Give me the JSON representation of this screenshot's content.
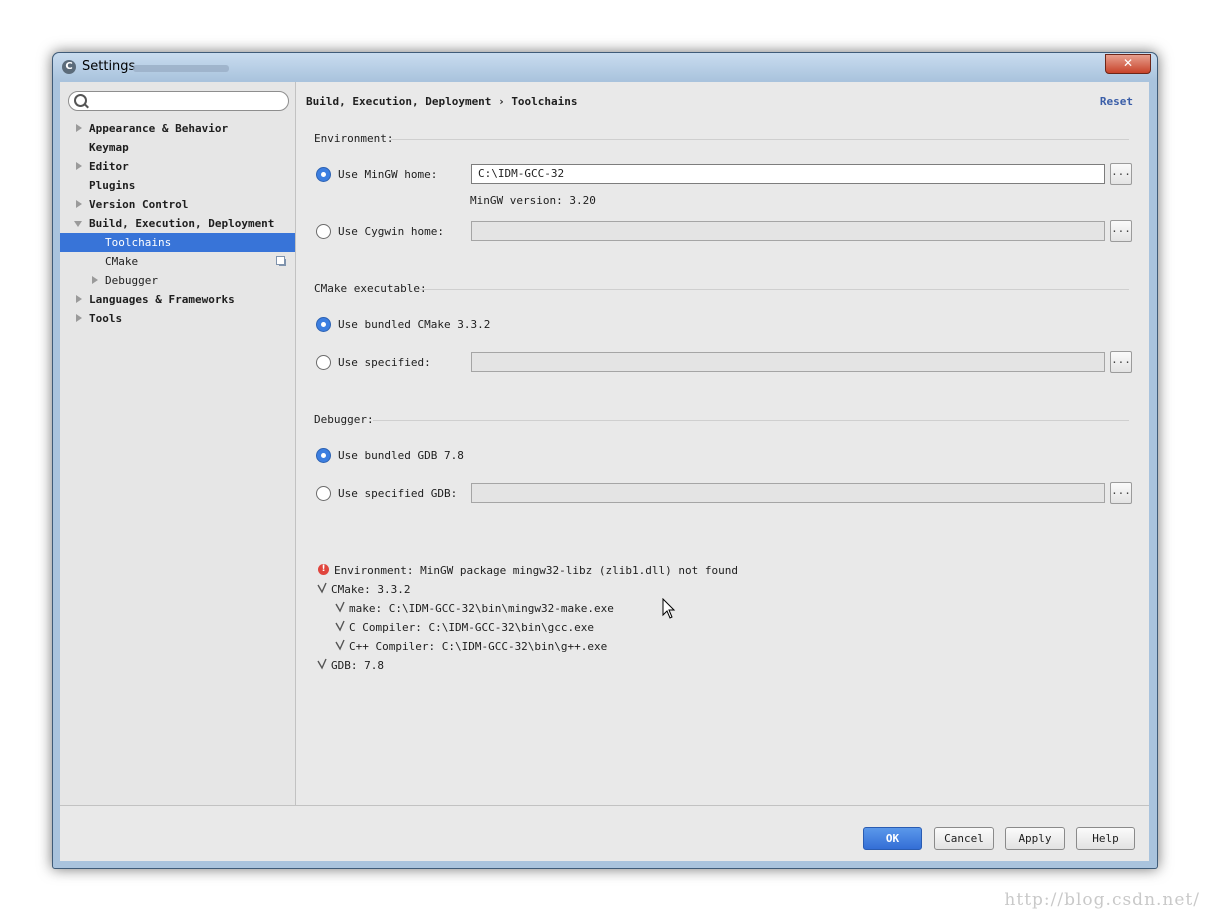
{
  "window": {
    "title": "Settings",
    "close_glyph": "✕"
  },
  "search": {
    "placeholder": ""
  },
  "sidebar": {
    "items": [
      {
        "label": "Appearance & Behavior"
      },
      {
        "label": "Keymap"
      },
      {
        "label": "Editor"
      },
      {
        "label": "Plugins"
      },
      {
        "label": "Version Control"
      },
      {
        "label": "Build, Execution, Deployment"
      },
      {
        "label": "Toolchains"
      },
      {
        "label": "CMake"
      },
      {
        "label": "Debugger"
      },
      {
        "label": "Languages & Frameworks"
      },
      {
        "label": "Tools"
      }
    ]
  },
  "header": {
    "crumb_parent": "Build, Execution, Deployment",
    "crumb_sep": "›",
    "crumb_current": "Toolchains",
    "reset": "Reset"
  },
  "environment": {
    "title": "Environment:",
    "mingw_label": "Use MinGW home:",
    "mingw_value": "C:\\IDM-GCC-32",
    "mingw_version": "MinGW version: 3.20",
    "cygwin_label": "Use Cygwin home:",
    "cygwin_value": ""
  },
  "cmake": {
    "title": "CMake executable:",
    "bundled_label": "Use bundled CMake 3.3.2",
    "specified_label": "Use specified:",
    "specified_value": ""
  },
  "debugger": {
    "title": "Debugger:",
    "bundled_label": "Use bundled GDB 7.8",
    "specified_label": "Use specified GDB:",
    "specified_value": ""
  },
  "browse_label": "...",
  "status": {
    "error_glyph": "!",
    "error": "Environment: MinGW package mingw32-libz (zlib1.dll) not found",
    "cmake": "CMake: 3.3.2",
    "make": "make: C:\\IDM-GCC-32\\bin\\mingw32-make.exe",
    "c_compiler": "C Compiler: C:\\IDM-GCC-32\\bin\\gcc.exe",
    "cpp_compiler": "C++ Compiler: C:\\IDM-GCC-32\\bin\\g++.exe",
    "gdb": "GDB: 7.8"
  },
  "buttons": {
    "ok": "OK",
    "cancel": "Cancel",
    "apply": "Apply",
    "help": "Help"
  },
  "watermark": "http://blog.csdn.net/"
}
